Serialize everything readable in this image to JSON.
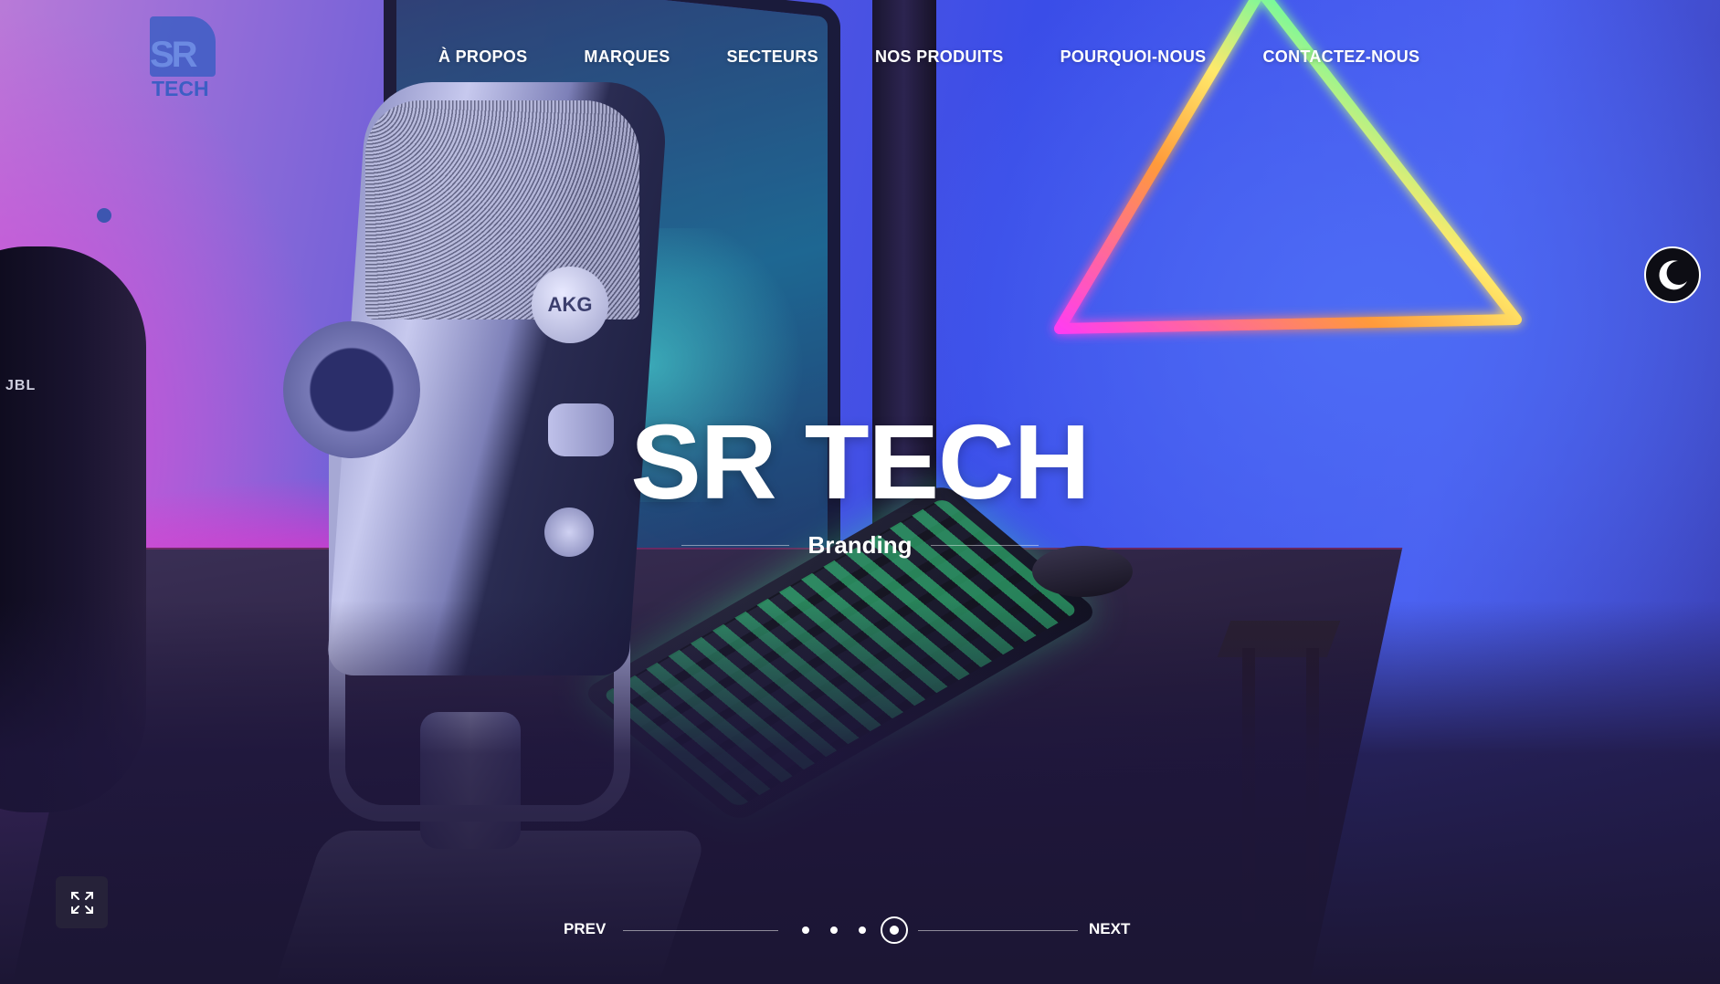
{
  "brand": {
    "logo_top": "SR",
    "logo_bottom": "TECH",
    "logo_accent": "#3d5ec4"
  },
  "nav": {
    "items": [
      {
        "label": "À PROPOS"
      },
      {
        "label": "MARQUES"
      },
      {
        "label": "SECTEURS"
      },
      {
        "label": "NOS PRODUITS"
      },
      {
        "label": "POURQUOI-NOUS"
      },
      {
        "label": "CONTACTEZ-NOUS"
      }
    ]
  },
  "hero": {
    "title": "SR TECH",
    "subtitle": "Branding",
    "background_icon": "gaming-desk-photo",
    "microphone_brand": "AKG",
    "speaker_brand": "JBL"
  },
  "slider": {
    "prev_label": "PREV",
    "next_label": "NEXT",
    "slide_count": 4,
    "active_slide": 4
  },
  "controls": {
    "theme_toggle_icon": "moon-icon",
    "fullscreen_icon": "expand-icon"
  },
  "colors": {
    "text": "#ffffff",
    "toggle_bg": "#0d0d14",
    "indicator_dot": "#3d56b0"
  }
}
